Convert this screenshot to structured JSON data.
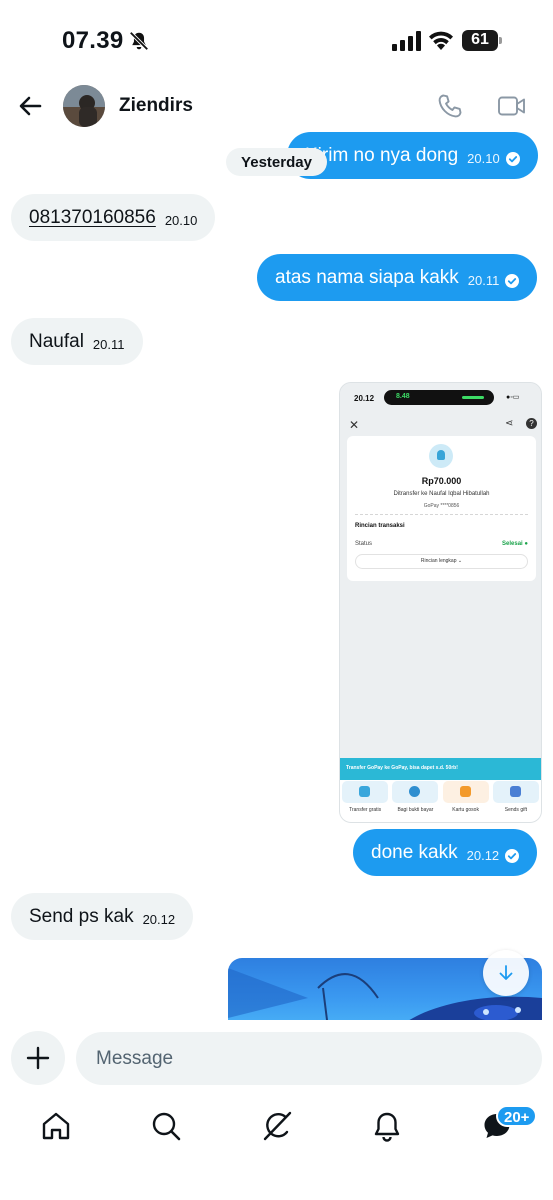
{
  "status_bar": {
    "time": "07.39",
    "battery": "61"
  },
  "header": {
    "contact_name": "Ziendirs"
  },
  "date_separator": "Yesterday",
  "messages": [
    {
      "direction": "out",
      "text": "Kirim no nya dong",
      "time": "20.10",
      "read": true
    },
    {
      "direction": "in",
      "text": "081370160856",
      "time": "20.10"
    },
    {
      "direction": "out",
      "text": "atas nama siapa kakk",
      "time": "20.11",
      "read": true
    },
    {
      "direction": "in",
      "text": "Naufal",
      "time": "20.11"
    },
    {
      "direction": "out",
      "type": "image",
      "description": "payment receipt screenshot"
    },
    {
      "direction": "out",
      "text": "done kakk",
      "time": "20.12",
      "read": true
    },
    {
      "direction": "in",
      "text": "Send ps kak",
      "time": "20.12"
    },
    {
      "direction": "out",
      "type": "image",
      "description": "image preview"
    }
  ],
  "shared_screenshot": {
    "time": "20.12",
    "call_time": "8.48",
    "amount": "Rp70.000",
    "destination": "Ditransfer ke Naufal Iqbal Hibatullah",
    "account": "GoPay ****0856",
    "section_title": "Rincian transaksi",
    "status_label": "Status",
    "status_value": "Selesai",
    "details_button": "Rincian lengkap",
    "promo": "Transfer GoPay ke GoPay, bisa dapet s.d. 50rb!",
    "actions": [
      "Transfer gratis",
      "Bagi bukti bayar",
      "Kartu gosok",
      "Sends gift"
    ]
  },
  "composer": {
    "placeholder": "Message"
  },
  "tabbar": {
    "messages_badge": "20+"
  },
  "colors": {
    "accent": "#1d9bf0",
    "incoming_bubble": "#eff3f4",
    "text": "#0f1419"
  },
  "icons": [
    "bell-off-icon",
    "signal-icon",
    "wifi-icon",
    "battery-icon",
    "back-arrow-icon",
    "phone-icon",
    "video-icon",
    "plus-icon",
    "home-icon",
    "search-icon",
    "grok-icon",
    "bell-icon",
    "messages-icon",
    "arrow-down-icon",
    "read-check-icon"
  ]
}
